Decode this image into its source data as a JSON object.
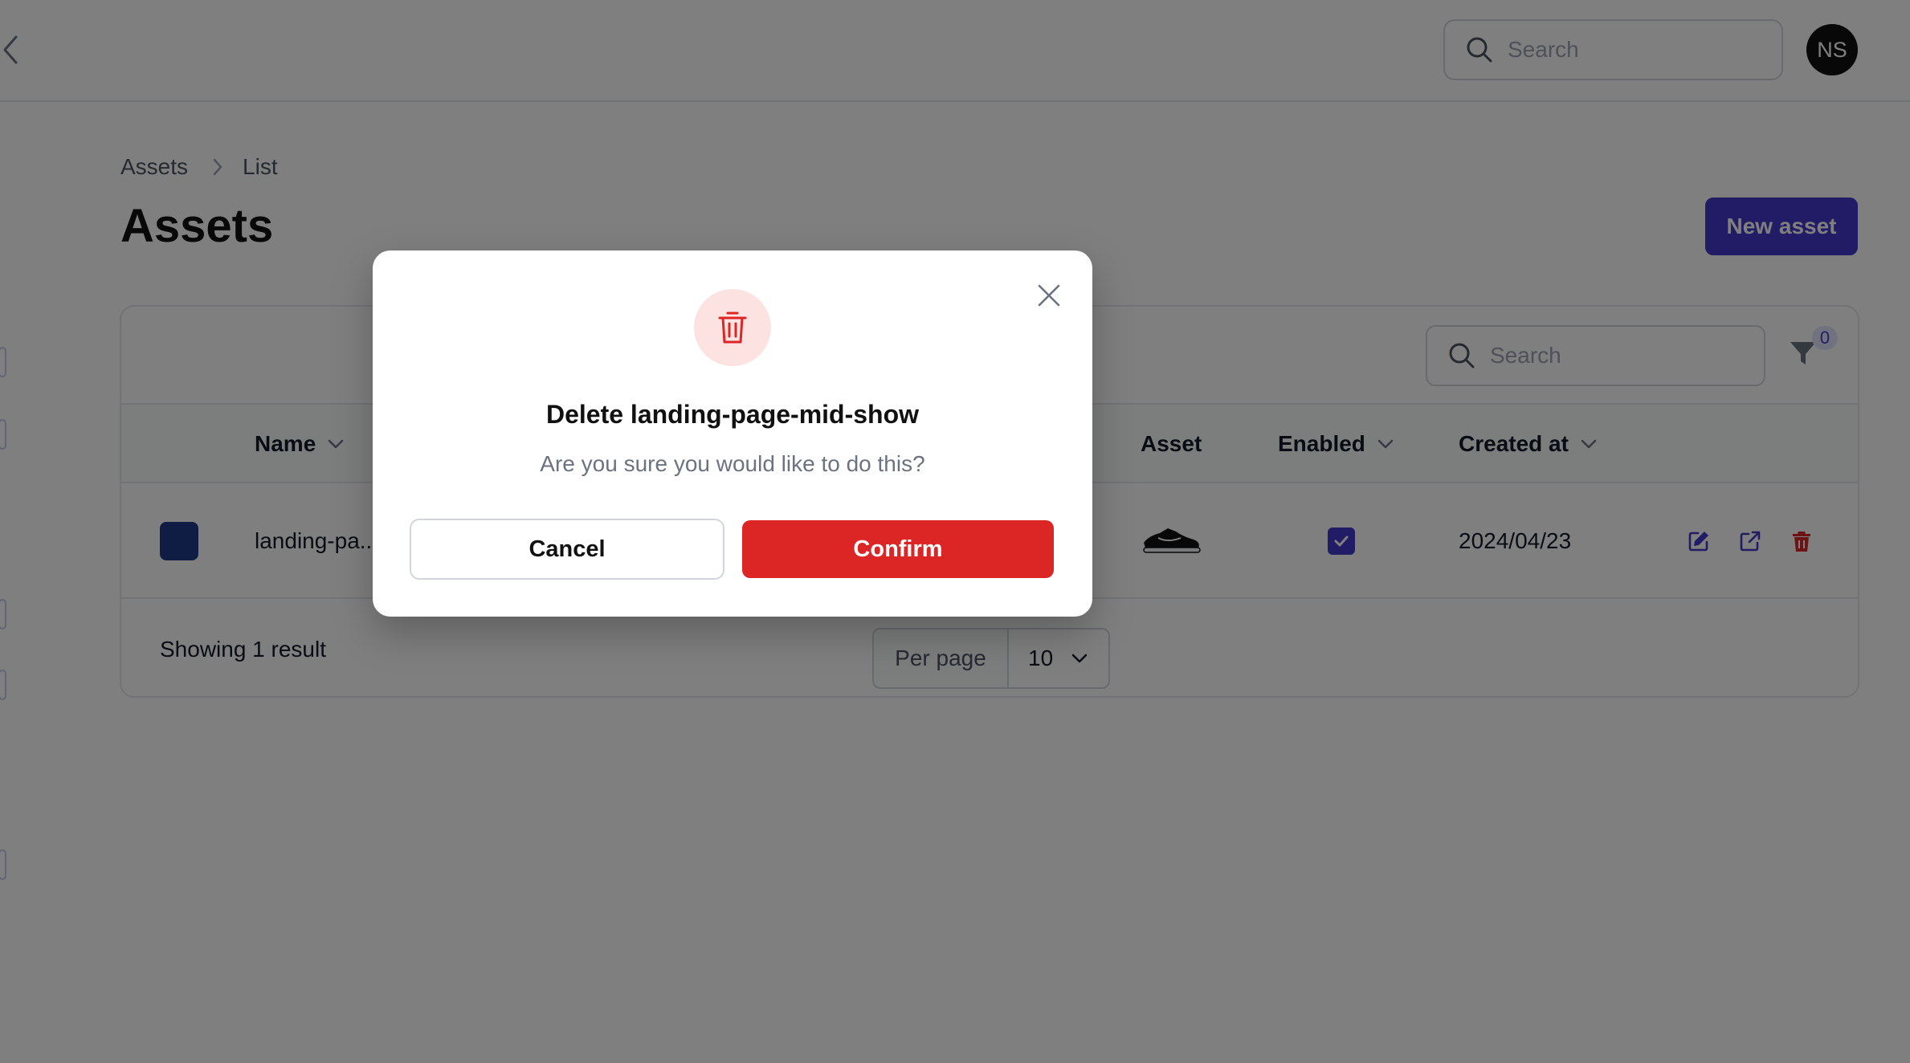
{
  "header": {
    "search_placeholder": "Search",
    "avatar_initials": "NS"
  },
  "breadcrumb": {
    "items": [
      "Assets",
      "List"
    ]
  },
  "page": {
    "title": "Assets",
    "new_button_label": "New asset"
  },
  "table": {
    "search_placeholder": "Search",
    "filter_count": "0",
    "columns": [
      "Name",
      "Asset",
      "Enabled",
      "Created at"
    ],
    "rows": [
      {
        "name": "landing-pa...",
        "swatch_color": "#1e3a8a",
        "asset_icon": "shoe-image",
        "enabled": true,
        "created_at": "2024/04/23"
      }
    ],
    "footer": {
      "showing": "Showing 1 result",
      "per_page_label": "Per page",
      "per_page_value": "10"
    }
  },
  "modal": {
    "icon": "trash-icon",
    "title": "Delete landing-page-mid-show",
    "description": "Are you sure you would like to do this?",
    "cancel_label": "Cancel",
    "confirm_label": "Confirm"
  },
  "colors": {
    "accent": "#4338ca",
    "danger": "#dc2626",
    "overlay": "rgba(0,0,0,0.5)"
  }
}
